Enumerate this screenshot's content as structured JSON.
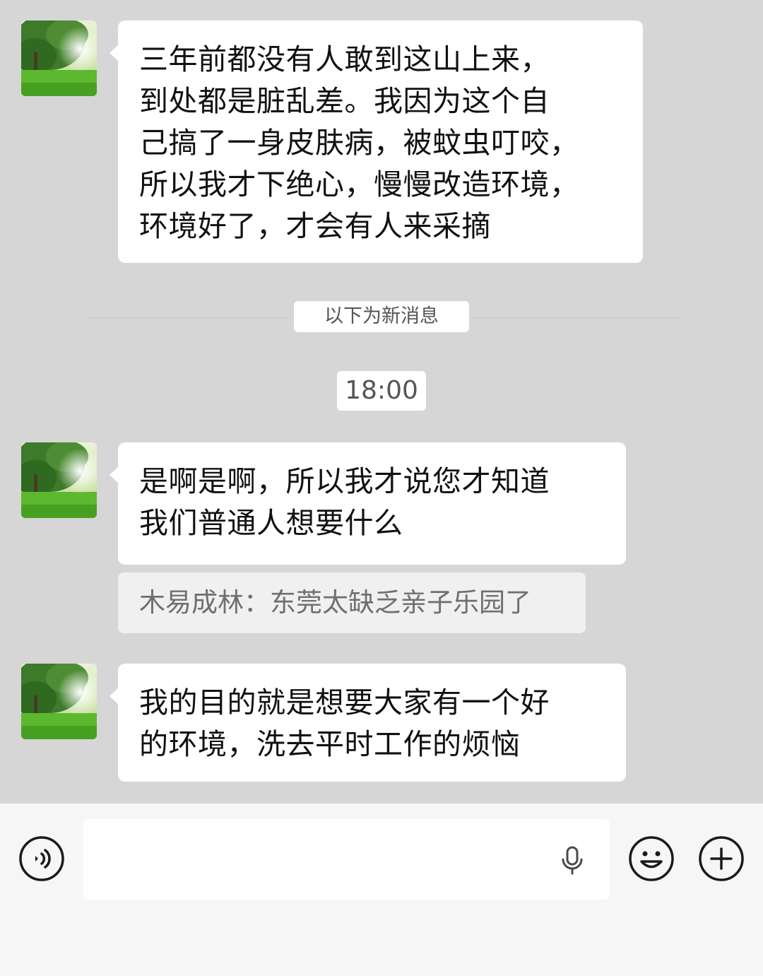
{
  "messages": [
    {
      "sender_side": "left",
      "lines": [
        "三年前都没有人敢到这山上来，",
        "到处都是脏乱差。我因为这个自",
        "己搞了一身皮肤病，被蚊虫叮咬，",
        "所以我才下绝心，慢慢改造环境，",
        "环境好了，才会有人来采摘"
      ]
    },
    {
      "sender_side": "left",
      "lines": [
        "是啊是啊，所以我才说您才知道",
        "我们普通人想要什么"
      ],
      "quote": "木易成林：东莞太缺乏亲子乐园了"
    },
    {
      "sender_side": "left",
      "lines": [
        "我的目的就是想要大家有一个好",
        "的环境，洗去平时工作的烦恼"
      ]
    }
  ],
  "new_messages_divider": "以下为新消息",
  "timestamp": "18:00",
  "input_bar": {
    "voice_icon": "voice-icon",
    "mic_icon": "microphone-icon",
    "emoji_icon": "emoji-icon",
    "plus_icon": "plus-icon",
    "text": ""
  },
  "colors": {
    "chat_background": "#d6d6d6",
    "bubble": "#ffffff",
    "input_bar": "#f6f6f6"
  }
}
